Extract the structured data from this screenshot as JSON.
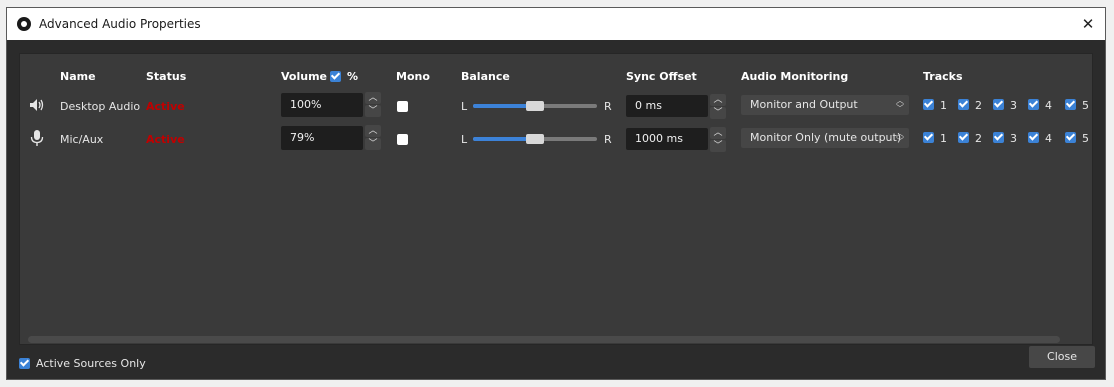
{
  "window": {
    "title": "Advanced Audio Properties",
    "close_glyph": "✕"
  },
  "columns": {
    "name": "Name",
    "status": "Status",
    "volume": "Volume",
    "volume_unit": "%",
    "mono": "Mono",
    "balance": "Balance",
    "sync_offset": "Sync Offset",
    "audio_monitoring": "Audio Monitoring",
    "tracks": "Tracks"
  },
  "volume_percent_checked": true,
  "rows": [
    {
      "icon": "speaker-icon",
      "name": "Desktop Audio",
      "status": "Active",
      "volume": "100%",
      "mono": false,
      "balance_left": "L",
      "balance_right": "R",
      "balance_value": 0.5,
      "sync_offset": "0 ms",
      "monitoring": "Monitor and Output",
      "tracks": [
        {
          "label": "1",
          "checked": true
        },
        {
          "label": "2",
          "checked": true
        },
        {
          "label": "3",
          "checked": true
        },
        {
          "label": "4",
          "checked": true
        },
        {
          "label": "5",
          "checked": true
        }
      ]
    },
    {
      "icon": "microphone-icon",
      "name": "Mic/Aux",
      "status": "Active",
      "volume": "79%",
      "mono": false,
      "balance_left": "L",
      "balance_right": "R",
      "balance_value": 0.5,
      "sync_offset": "1000 ms",
      "monitoring": "Monitor Only (mute output)",
      "tracks": [
        {
          "label": "1",
          "checked": true
        },
        {
          "label": "2",
          "checked": true
        },
        {
          "label": "3",
          "checked": true
        },
        {
          "label": "4",
          "checked": true
        },
        {
          "label": "5",
          "checked": true
        }
      ]
    }
  ],
  "footer": {
    "active_sources_only_label": "Active Sources Only",
    "active_sources_only_checked": true,
    "close_label": "Close"
  },
  "colors": {
    "accent": "#3b82d6",
    "status_active": "#c00000",
    "background": "#2b2b2b",
    "panel": "#3a3a3a"
  }
}
